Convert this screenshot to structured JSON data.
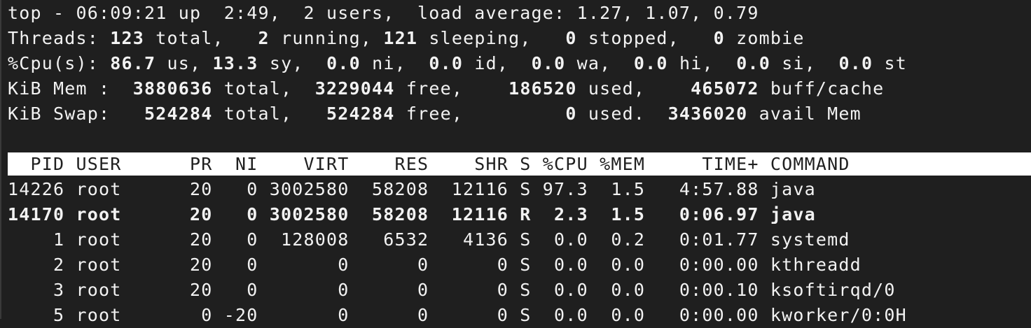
{
  "summary": {
    "uptime_line": [
      {
        "t": "top - 06:09:21 up  2:49,  2 users,  load average: 1.27, 1.07, 0.79",
        "b": false
      }
    ],
    "threads_line": [
      {
        "t": "Threads: ",
        "b": false
      },
      {
        "t": "123",
        "b": true
      },
      {
        "t": " total,   ",
        "b": false
      },
      {
        "t": "2",
        "b": true
      },
      {
        "t": " running, ",
        "b": false
      },
      {
        "t": "121",
        "b": true
      },
      {
        "t": " sleeping,   ",
        "b": false
      },
      {
        "t": "0",
        "b": true
      },
      {
        "t": " stopped,   ",
        "b": false
      },
      {
        "t": "0",
        "b": true
      },
      {
        "t": " zombie",
        "b": false
      }
    ],
    "cpu_line": [
      {
        "t": "%Cpu(s): ",
        "b": false
      },
      {
        "t": "86.7",
        "b": true
      },
      {
        "t": " us, ",
        "b": false
      },
      {
        "t": "13.3",
        "b": true
      },
      {
        "t": " sy,  ",
        "b": false
      },
      {
        "t": "0.0",
        "b": true
      },
      {
        "t": " ni,  ",
        "b": false
      },
      {
        "t": "0.0",
        "b": true
      },
      {
        "t": " id,  ",
        "b": false
      },
      {
        "t": "0.0",
        "b": true
      },
      {
        "t": " wa,  ",
        "b": false
      },
      {
        "t": "0.0",
        "b": true
      },
      {
        "t": " hi,  ",
        "b": false
      },
      {
        "t": "0.0",
        "b": true
      },
      {
        "t": " si,  ",
        "b": false
      },
      {
        "t": "0.0",
        "b": true
      },
      {
        "t": " st",
        "b": false
      }
    ],
    "mem_line": [
      {
        "t": "KiB Mem :  ",
        "b": false
      },
      {
        "t": "3880636",
        "b": true
      },
      {
        "t": " total,  ",
        "b": false
      },
      {
        "t": "3229044",
        "b": true
      },
      {
        "t": " free,    ",
        "b": false
      },
      {
        "t": "186520",
        "b": true
      },
      {
        "t": " used,    ",
        "b": false
      },
      {
        "t": "465072",
        "b": true
      },
      {
        "t": " buff/cache",
        "b": false
      }
    ],
    "swap_line": [
      {
        "t": "KiB Swap:   ",
        "b": false
      },
      {
        "t": "524284",
        "b": true
      },
      {
        "t": " total,   ",
        "b": false
      },
      {
        "t": "524284",
        "b": true
      },
      {
        "t": " free,         ",
        "b": false
      },
      {
        "t": "0",
        "b": true
      },
      {
        "t": " used.  ",
        "b": false
      },
      {
        "t": "3436020",
        "b": true
      },
      {
        "t": " avail Mem",
        "b": false
      }
    ]
  },
  "table": {
    "header": "  PID USER      PR  NI    VIRT    RES    SHR S %CPU %MEM     TIME+ COMMAND",
    "rows": [
      {
        "text": "14226 root      20   0 3002580  58208  12116 S 97.3  1.5   4:57.88 java",
        "bold": false
      },
      {
        "text": "14170 root      20   0 3002580  58208  12116 R  2.3  1.5   0:06.97 java",
        "bold": true
      },
      {
        "text": "    1 root      20   0  128008   6532   4136 S  0.0  0.2   0:01.77 systemd",
        "bold": false
      },
      {
        "text": "    2 root      20   0       0      0      0 S  0.0  0.0   0:00.00 kthreadd",
        "bold": false
      },
      {
        "text": "    3 root      20   0       0      0      0 S  0.0  0.0   0:00.10 ksoftirqd/0",
        "bold": false
      },
      {
        "text": "    5 root       0 -20       0      0      0 S  0.0  0.0   0:00.00 kworker/0:0H",
        "bold": false
      }
    ]
  },
  "colors": {
    "background": "#1f1f1f",
    "foreground": "#f2f2f2",
    "header_bar": "#ffffff"
  }
}
